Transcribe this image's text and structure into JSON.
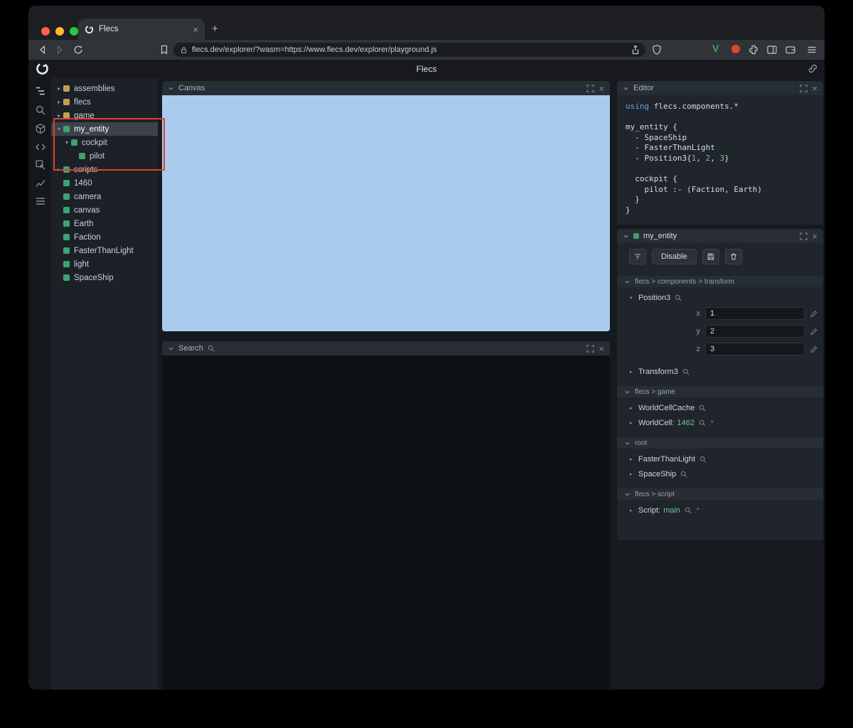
{
  "icons": {
    "close": "×",
    "plus": "+",
    "expander_open": "▾",
    "expander_closed": "▸"
  },
  "browser": {
    "tab_title": "Flecs",
    "url": "flecs.dev/explorer/?wasm=https://www.flecs.dev/explorer/playground.js",
    "extension_v_label": "V"
  },
  "app": {
    "title": "Flecs"
  },
  "panels": {
    "canvas": {
      "title": "Canvas"
    },
    "search": {
      "title": "Search"
    },
    "editor": {
      "title": "Editor"
    }
  },
  "tree": {
    "items": [
      {
        "label": "assemblies",
        "depth": 0,
        "kind": "module",
        "expander": "closed"
      },
      {
        "label": "flecs",
        "depth": 0,
        "kind": "module",
        "expander": "closed"
      },
      {
        "label": "game",
        "depth": 0,
        "kind": "module",
        "expander": "closed"
      },
      {
        "label": "my_entity",
        "depth": 0,
        "kind": "entity",
        "expander": "open",
        "selected": true
      },
      {
        "label": "cockpit",
        "depth": 1,
        "kind": "entity",
        "expander": "open"
      },
      {
        "label": "pilot",
        "depth": 2,
        "kind": "entity",
        "expander": "none"
      },
      {
        "label": "scripts",
        "depth": 0,
        "kind": "entity",
        "expander": "closed"
      },
      {
        "label": "1460",
        "depth": 0,
        "kind": "entity",
        "expander": "none"
      },
      {
        "label": "camera",
        "depth": 0,
        "kind": "entity",
        "expander": "none"
      },
      {
        "label": "canvas",
        "depth": 0,
        "kind": "entity",
        "expander": "none"
      },
      {
        "label": "Earth",
        "depth": 0,
        "kind": "entity",
        "expander": "none"
      },
      {
        "label": "Faction",
        "depth": 0,
        "kind": "entity",
        "expander": "none"
      },
      {
        "label": "FasterThanLight",
        "depth": 0,
        "kind": "entity",
        "expander": "none"
      },
      {
        "label": "light",
        "depth": 0,
        "kind": "entity",
        "expander": "none"
      },
      {
        "label": "SpaceShip",
        "depth": 0,
        "kind": "entity",
        "expander": "none"
      }
    ]
  },
  "editor_code": {
    "lines": [
      [
        {
          "t": "using ",
          "c": "kw"
        },
        {
          "t": "flecs.components.*",
          "c": "plain"
        }
      ],
      [],
      [
        {
          "t": "my_entity {",
          "c": "plain"
        }
      ],
      [
        {
          "t": "  - SpaceShip",
          "c": "plain"
        }
      ],
      [
        {
          "t": "  - FasterThanLight",
          "c": "plain"
        }
      ],
      [
        {
          "t": "  - Position3{",
          "c": "plain"
        },
        {
          "t": "1",
          "c": "num"
        },
        {
          "t": ", ",
          "c": "plain"
        },
        {
          "t": "2",
          "c": "num"
        },
        {
          "t": ", ",
          "c": "plain"
        },
        {
          "t": "3",
          "c": "num"
        },
        {
          "t": "}",
          "c": "plain"
        }
      ],
      [],
      [
        {
          "t": "  cockpit {",
          "c": "plain"
        }
      ],
      [
        {
          "t": "    pilot :- (Faction, Earth)",
          "c": "plain"
        }
      ],
      [
        {
          "t": "  }",
          "c": "plain"
        }
      ],
      [
        {
          "t": "}",
          "c": "plain"
        }
      ]
    ]
  },
  "inspector": {
    "title": "my_entity",
    "disable_label": "Disable",
    "sections": [
      {
        "path": "flecs > components > transform",
        "items": [
          {
            "name": "Position3",
            "expander": "open",
            "fields": [
              {
                "label": "x",
                "value": "1"
              },
              {
                "label": "y",
                "value": "2"
              },
              {
                "label": "z",
                "value": "3"
              }
            ]
          },
          {
            "name": "Transform3",
            "expander": "closed"
          }
        ]
      },
      {
        "path": "flecs > game",
        "items": [
          {
            "name": "WorldCellCache",
            "expander": "closed"
          },
          {
            "name": "WorldCell:",
            "value": "1462",
            "expander": "closed",
            "suffix": ".*"
          }
        ]
      },
      {
        "path": "root",
        "items": [
          {
            "name": "FasterThanLight",
            "expander": "closed"
          },
          {
            "name": "SpaceShip",
            "expander": "closed"
          }
        ]
      },
      {
        "path": "flecs > script",
        "items": [
          {
            "name": "Script:",
            "value": "main",
            "expander": "closed",
            "suffix": ".*"
          }
        ]
      }
    ]
  },
  "colors": {
    "entity_green": "#3fa272",
    "module_yellow": "#c2a14c",
    "canvas_blue": "#a9cbee",
    "annotation_red": "#e03f2d",
    "code_keyword": "#5fa8dd",
    "code_number": "#77c395",
    "value_green": "#77c395"
  }
}
